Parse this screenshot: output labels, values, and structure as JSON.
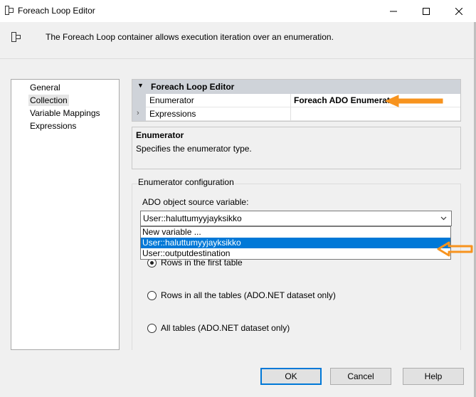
{
  "window": {
    "title": "Foreach Loop Editor",
    "icon": "foreach-loop-icon"
  },
  "description": {
    "text": "The Foreach Loop container allows execution iteration over an enumeration.",
    "icon": "container-icon"
  },
  "left_nav": {
    "items": [
      {
        "label": "General"
      },
      {
        "label": "Collection",
        "selected": true
      },
      {
        "label": "Variable Mappings"
      },
      {
        "label": "Expressions"
      }
    ]
  },
  "property_grid": {
    "category": "Foreach Loop Editor",
    "rows": [
      {
        "name": "Enumerator",
        "value": "Foreach ADO Enumerat"
      },
      {
        "name": "Expressions",
        "value": ""
      }
    ]
  },
  "help": {
    "title": "Enumerator",
    "body": "Specifies the enumerator type."
  },
  "config": {
    "group_label": "Enumerator configuration",
    "ado_label": "ADO object source variable:",
    "selected_value": "User::haluttumyyjayksikko",
    "dropdown_options": [
      "New variable ...",
      "User::haluttumyyjayksikko",
      "User::outputdestination"
    ],
    "radio_options": [
      {
        "label": "Rows in the first table",
        "checked": true
      },
      {
        "label": "Rows in all the tables (ADO.NET dataset only)",
        "checked": false
      },
      {
        "label": "All tables (ADO.NET dataset only)",
        "checked": false
      }
    ]
  },
  "buttons": {
    "ok": "OK",
    "cancel": "Cancel",
    "help": "Help"
  },
  "colors": {
    "selection": "#0078d7",
    "annotation_arrow": "#f7931e"
  }
}
